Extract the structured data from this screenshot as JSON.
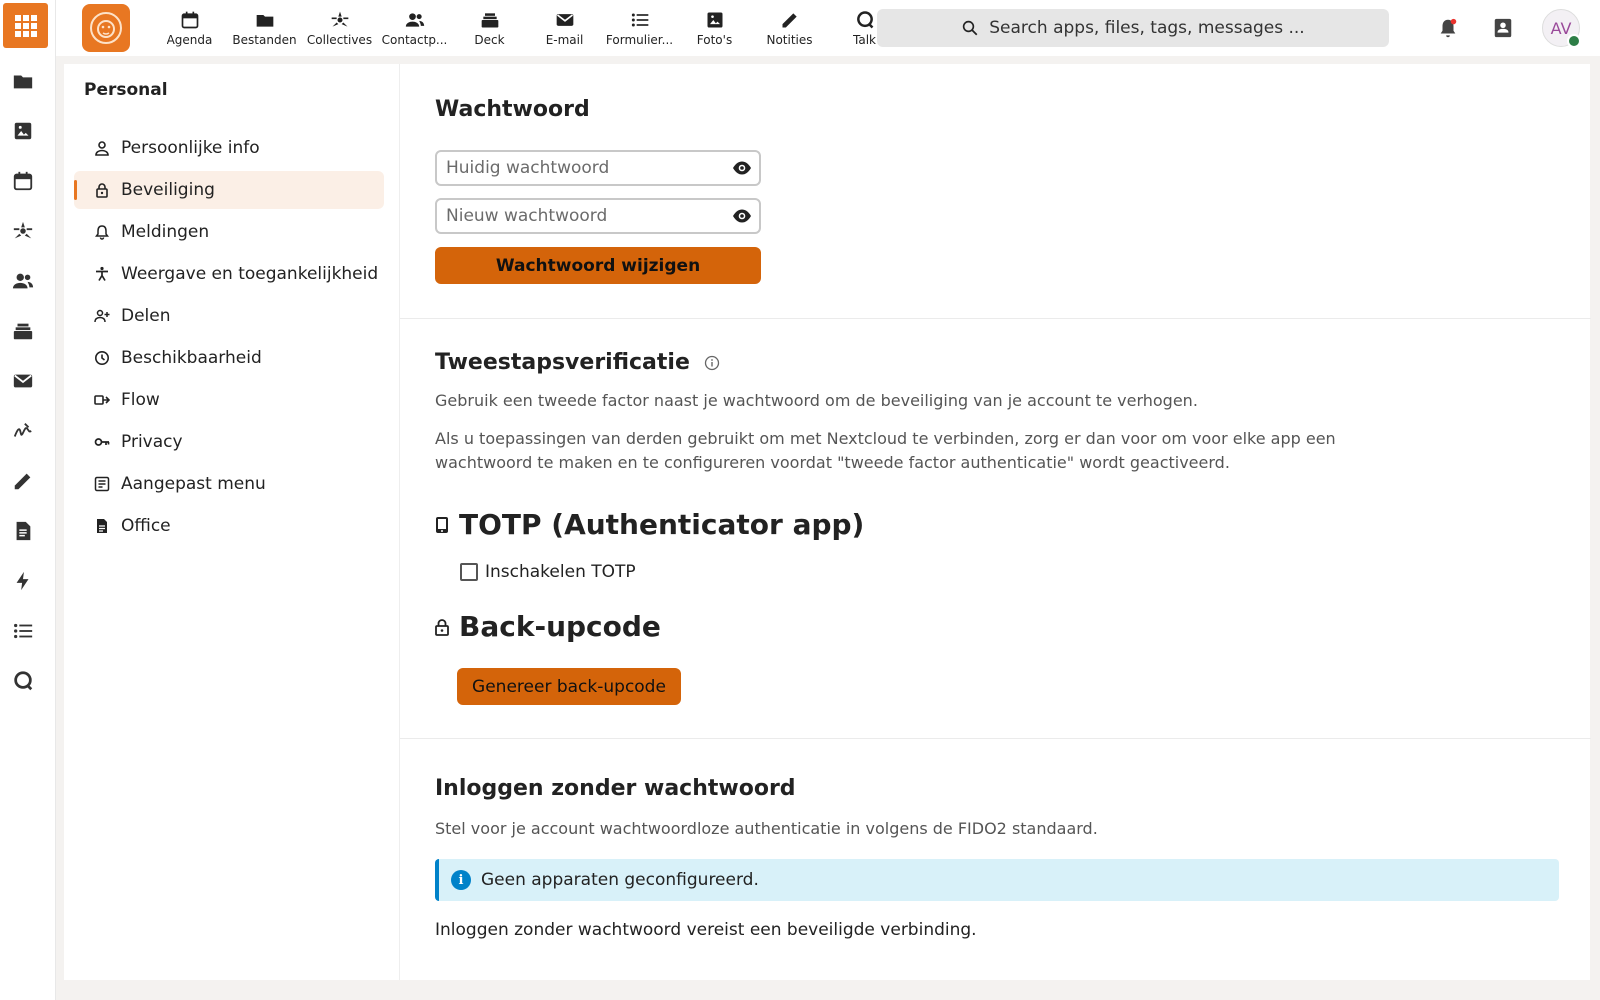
{
  "topbar": {
    "apps": [
      {
        "label": "Agenda",
        "icon": "calendar-icon"
      },
      {
        "label": "Bestanden",
        "icon": "folder-icon"
      },
      {
        "label": "Collectives",
        "icon": "collectives-icon"
      },
      {
        "label": "Contactp...",
        "icon": "contacts-icon"
      },
      {
        "label": "Deck",
        "icon": "deck-icon"
      },
      {
        "label": "E-mail",
        "icon": "mail-icon"
      },
      {
        "label": "Formulier...",
        "icon": "forms-icon"
      },
      {
        "label": "Foto's",
        "icon": "photos-icon"
      },
      {
        "label": "Notities",
        "icon": "notes-icon"
      },
      {
        "label": "Talk",
        "icon": "talk-icon"
      }
    ],
    "search_placeholder": "Search apps, files, tags, messages ...",
    "avatar_initials": "AV"
  },
  "rail": {
    "icons": [
      "folder-icon",
      "photos-icon",
      "calendar-icon",
      "collectives-icon",
      "contacts-icon",
      "deck-icon",
      "mail-icon",
      "signature-icon",
      "notes-icon",
      "document-icon",
      "flow-icon",
      "list-icon",
      "talk-icon"
    ]
  },
  "settings_nav": {
    "heading": "Personal",
    "items": [
      {
        "label": "Persoonlijke info",
        "icon": "person-icon",
        "active": false
      },
      {
        "label": "Beveiliging",
        "icon": "lock-icon",
        "active": true
      },
      {
        "label": "Meldingen",
        "icon": "bell-icon",
        "active": false
      },
      {
        "label": "Weergave en toegankelijkheid",
        "icon": "accessibility-icon",
        "active": false
      },
      {
        "label": "Delen",
        "icon": "share-icon",
        "active": false
      },
      {
        "label": "Beschikbaarheid",
        "icon": "clock-icon",
        "active": false
      },
      {
        "label": "Flow",
        "icon": "flow-icon",
        "active": false
      },
      {
        "label": "Privacy",
        "icon": "key-icon",
        "active": false
      },
      {
        "label": "Aangepast menu",
        "icon": "menu-icon",
        "active": false
      },
      {
        "label": "Office",
        "icon": "office-icon",
        "active": false
      }
    ]
  },
  "password": {
    "title": "Wachtwoord",
    "current_placeholder": "Huidig wachtwoord",
    "new_placeholder": "Nieuw wachtwoord",
    "change_button": "Wachtwoord wijzigen"
  },
  "twofactor": {
    "title": "Tweestapsverificatie",
    "intro": "Gebruik een tweede factor naast je wachtwoord om de beveiliging van je account te verhogen.",
    "warning": "Als u toepassingen van derden gebruikt om met Nextcloud te verbinden, zorg er dan voor om voor elke app een wachtwoord te maken en te configureren voordat \"tweede factor authenticatie\" wordt geactiveerd.",
    "totp_title": "TOTP (Authenticator app)",
    "totp_checkbox": "Inschakelen TOTP",
    "backup_title": "Back-upcode",
    "backup_button": "Genereer back-upcode"
  },
  "passwordless": {
    "title": "Inloggen zonder wachtwoord",
    "intro": "Stel voor je account wachtwoordloze authenticatie in volgens de FIDO2 standaard.",
    "info": "Geen apparaten geconfigureerd.",
    "note": "Inloggen zonder wachtwoord vereist een beveiligde verbinding."
  },
  "colors": {
    "accent": "#e87722",
    "primary_button": "#d4640a",
    "info_bg": "#d8f1f9",
    "info_border": "#0082c9"
  }
}
